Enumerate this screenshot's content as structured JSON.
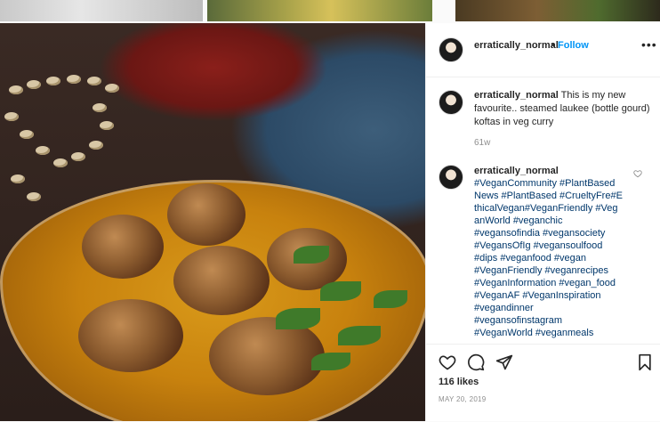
{
  "post": {
    "username": "erratically_normal",
    "follow_separator": "•",
    "follow_label": "Follow",
    "more_label": "•••",
    "caption_username": "erratically_normal",
    "caption_text": "This is my new favourite.. steamed laukee (bottle gourd) koftas in veg curry",
    "caption_time": "61w",
    "comment_username": "erratically_normal",
    "comment_tags": "#VeganCommunity  #PlantBased\nNews #PlantBased #CrueltyFre#E\nthicalVegan#VeganFriendly #Veg\nanWorld #veganchic\n#vegansofindia #vegansociety\n#VegansOfIg #vegansoulfood\n#dips #veganfood #vegan\n#VeganFriendly #veganrecipes\n#VeganInformation #vegan_food\n#VeganAF #VeganInspiration\n#vegandinner\n#vegansofinstagram\n#VeganWorld #veganmeals",
    "likes": "116 likes",
    "date": "MAY 20, 2019"
  },
  "icons": {
    "like": "heart-outline",
    "comment": "speech-bubble",
    "share": "paper-plane",
    "save": "bookmark",
    "comment_like": "small-heart"
  },
  "colors": {
    "link": "#0095f6",
    "hashtag": "#00376b",
    "muted": "#8e8e8e"
  }
}
